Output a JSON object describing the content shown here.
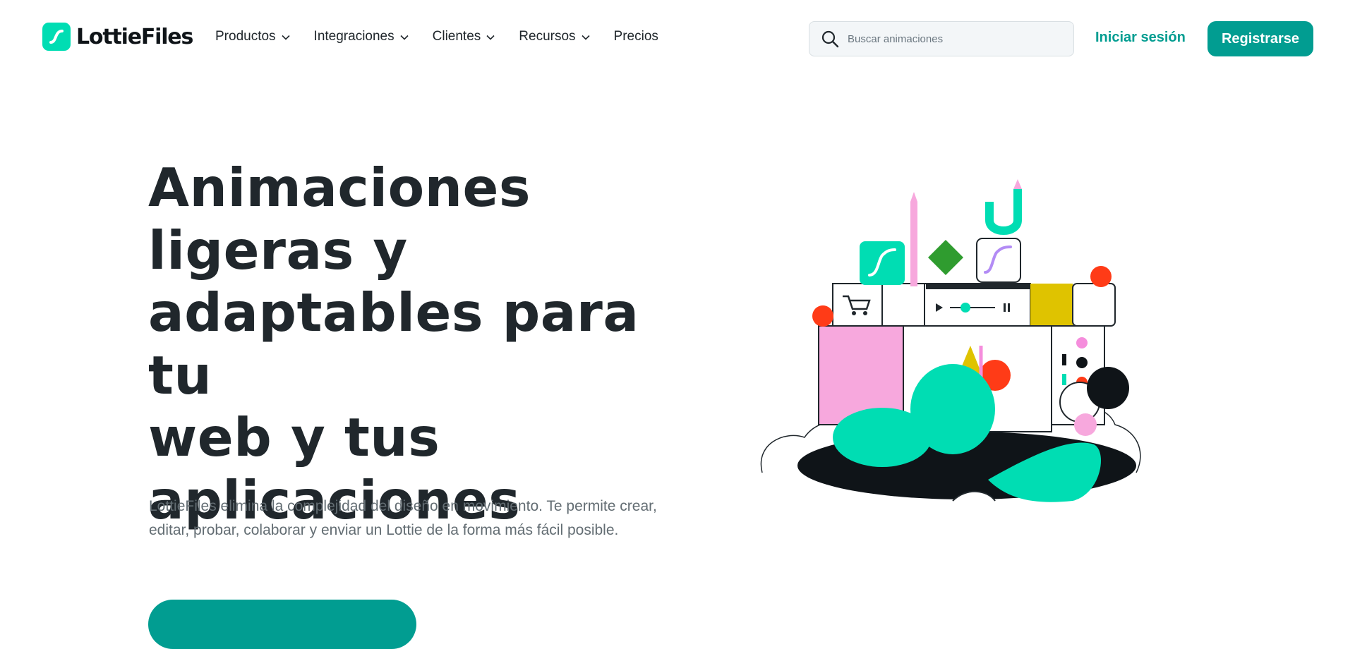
{
  "brand": {
    "name": "LottieFiles",
    "accent": "#019d91",
    "logo_color": "#00ddb3",
    "icon": "lottie-logo-icon"
  },
  "nav": {
    "items": [
      {
        "label": "Productos",
        "dropdown": true
      },
      {
        "label": "Integraciones",
        "dropdown": true
      },
      {
        "label": "Clientes",
        "dropdown": true
      },
      {
        "label": "Recursos",
        "dropdown": true
      },
      {
        "label": "Precios",
        "dropdown": false
      }
    ]
  },
  "search": {
    "placeholder": "Buscar animaciones",
    "value": "",
    "icon": "search-icon"
  },
  "auth": {
    "login_label": "Iniciar sesión",
    "signup_label": "Registrarse"
  },
  "hero": {
    "title_lines": [
      "Animaciones",
      "ligeras y",
      "adaptables para tu",
      "web y tus",
      "aplicaciones"
    ],
    "description": "LottieFiles elimina la complejidad del diseño en movimiento. Te permite crear, editar, probar, colaborar y enviar un Lottie de la forma más fácil posible."
  },
  "illustration": {
    "icon": "hero-illustration"
  }
}
